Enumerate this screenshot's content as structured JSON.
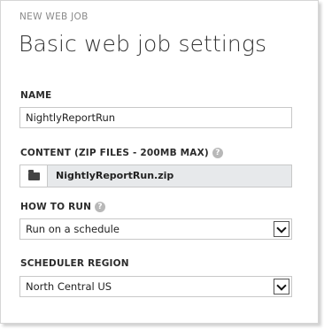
{
  "dialog": {
    "eyebrow": "NEW WEB JOB",
    "title": "Basic web job settings"
  },
  "name": {
    "label": "NAME",
    "value": "NightlyReportRun"
  },
  "content": {
    "label": "CONTENT (ZIP FILES - 200MB MAX)",
    "help_icon": "help-icon",
    "file_icon": "folder-icon",
    "file_name": "NightlyReportRun.zip"
  },
  "how_to_run": {
    "label": "HOW TO RUN",
    "help_icon": "help-icon",
    "selected": "Run on a schedule"
  },
  "scheduler_region": {
    "label": "SCHEDULER REGION",
    "selected": "North Central US"
  },
  "colors": {
    "file_field_bg": "#e7e9eb",
    "border": "#c8c8c8",
    "muted_text": "#8a8a8a"
  }
}
